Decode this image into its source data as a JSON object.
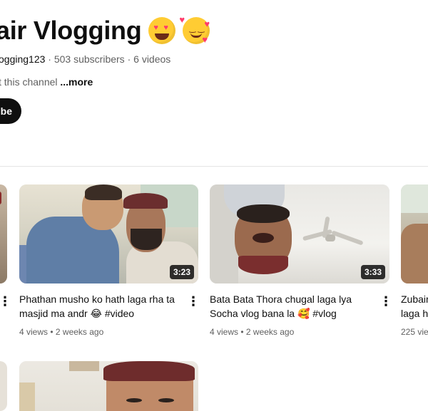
{
  "channel": {
    "title": "air Vlogging",
    "handle": "ogging123",
    "subscribers": "503 subscribers",
    "videos_count": "6 videos",
    "separator": "·",
    "about_text": "t this channel",
    "more_label": "...more",
    "subscribe_label": "be"
  },
  "videos": [
    {
      "title": "Phathan musho ko hath laga rha ta masjid ma andr 😂 #video",
      "views": "4 views",
      "age": "2 weeks ago",
      "duration": "3:23"
    },
    {
      "title": "Bata Bata Thora chugal laga lya Socha vlog bana la 🥰 #vlog",
      "views": "4 views",
      "age": "2 weeks ago",
      "duration": "3:33"
    },
    {
      "title": "Zubair laga h",
      "views": "225 vie"
    }
  ],
  "dot": "•",
  "kebab": "⋮",
  "colors": {
    "text": "#0f0f0f",
    "secondary": "#606060",
    "subscribe_bg": "#0f0f0f"
  }
}
